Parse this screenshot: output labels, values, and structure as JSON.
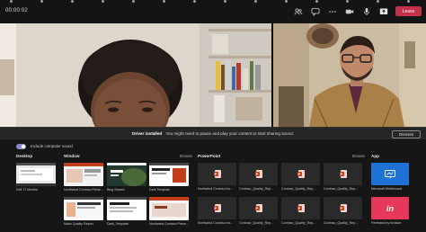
{
  "call": {
    "timer": "00:00:02",
    "leave_label": "Leave",
    "toolbar_icons": [
      "participants-icon",
      "chat-icon",
      "more-icon",
      "camera-icon",
      "mic-icon",
      "share-tray-icon"
    ]
  },
  "notification": {
    "title": "Driver installed",
    "message": "You might need to pause and play your content to start sharing sound.",
    "dismiss_label": "Dismiss"
  },
  "share_tray": {
    "include_sound_label": "Include computer sound",
    "include_sound_on": true,
    "desktop": {
      "title": "Desktop",
      "items": [
        {
          "label": "Dell 17 Monitor"
        }
      ]
    },
    "window": {
      "title": "Window",
      "browse_label": "Browse",
      "items": [
        {
          "label": "Northwind Contoso Prese..."
        },
        {
          "label": "Bing Search"
        },
        {
          "label": "Dark Template"
        },
        {
          "label": "Make Quality Report"
        },
        {
          "label": "Dark_Template"
        },
        {
          "label": "Northwind Contoso Prese..."
        }
      ]
    },
    "powerpoint": {
      "title": "PowerPoint",
      "browse_label": "Browse",
      "items": [
        {
          "label": "Northwind Contoso Inc..."
        },
        {
          "label": "Contoso_Quality_Rep..."
        },
        {
          "label": "Contoso_Quality_Rep..."
        },
        {
          "label": "Contoso_Quality_Rep..."
        },
        {
          "label": "Northwind Contoso Inc..."
        },
        {
          "label": "Contoso_Quality_Rep..."
        },
        {
          "label": "Contoso_Quality_Rep..."
        },
        {
          "label": "Contoso_Quality_Rep..."
        }
      ]
    },
    "app": {
      "title": "App",
      "items": [
        {
          "label": "Microsoft Whiteboard",
          "color": "#1e72d6"
        },
        {
          "label": "Freehand by Invision",
          "color": "#e8385a",
          "glyph": "in"
        }
      ]
    }
  },
  "colors": {
    "leave": "#c4314b",
    "toggle": "#8b8cc7",
    "powerpoint": "#c43e1c"
  }
}
